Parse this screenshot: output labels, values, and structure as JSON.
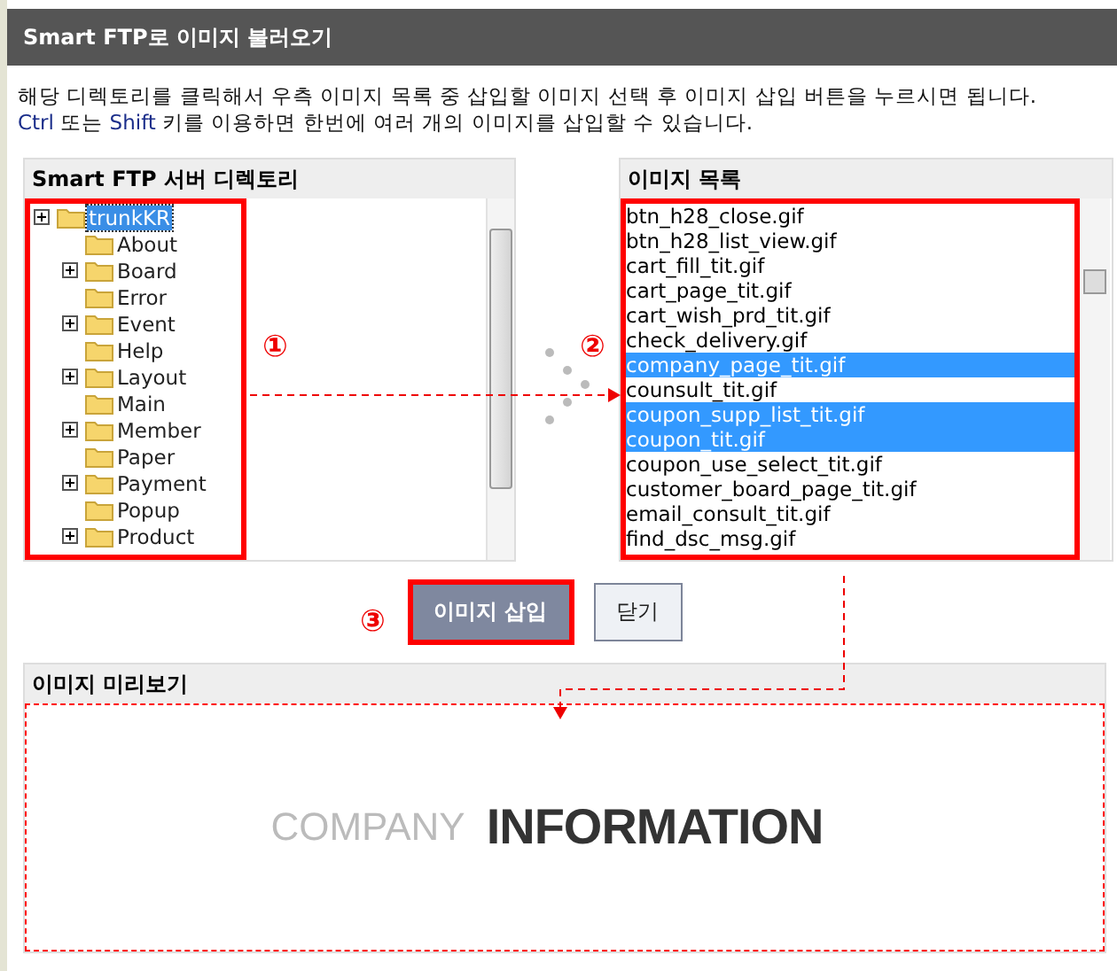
{
  "window": {
    "title": "Smart FTP로 이미지 불러오기"
  },
  "instructions": [
    {
      "segments": [
        {
          "kind": "plain",
          "text": "해당 디렉토리를 클릭해서 우측 이미지 목록 중 삽입할 이미지 선택 후 이미지 삽입 버튼을 누르시면 됩니다."
        }
      ]
    },
    {
      "segments": [
        {
          "kind": "key",
          "text": "Ctrl"
        },
        {
          "kind": "plain",
          "text": " 또는 "
        },
        {
          "kind": "key",
          "text": "Shift"
        },
        {
          "kind": "plain",
          "text": " 키를 이용하면 한번에 여러 개의 이미지를 삽입할 수 있습니다."
        }
      ]
    }
  ],
  "directory_panel": {
    "title": "Smart FTP 서버 디렉토리",
    "marker": "①",
    "root": {
      "label": "trunkKR",
      "expandable": true,
      "selected": true,
      "children": [
        {
          "label": "About",
          "expandable": false,
          "selected": false
        },
        {
          "label": "Board",
          "expandable": true,
          "selected": false
        },
        {
          "label": "Error",
          "expandable": false,
          "selected": false
        },
        {
          "label": "Event",
          "expandable": true,
          "selected": false
        },
        {
          "label": "Help",
          "expandable": false,
          "selected": false
        },
        {
          "label": "Layout",
          "expandable": true,
          "selected": false
        },
        {
          "label": "Main",
          "expandable": false,
          "selected": false
        },
        {
          "label": "Member",
          "expandable": true,
          "selected": false
        },
        {
          "label": "Paper",
          "expandable": false,
          "selected": false
        },
        {
          "label": "Payment",
          "expandable": true,
          "selected": false
        },
        {
          "label": "Popup",
          "expandable": false,
          "selected": false
        },
        {
          "label": "Product",
          "expandable": true,
          "selected": false
        }
      ]
    }
  },
  "image_panel": {
    "title": "이미지 목록",
    "marker": "②",
    "items": [
      {
        "label": "btn_h28_close.gif",
        "selected": false
      },
      {
        "label": "btn_h28_list_view.gif",
        "selected": false
      },
      {
        "label": "cart_fill_tit.gif",
        "selected": false
      },
      {
        "label": "cart_page_tit.gif",
        "selected": false
      },
      {
        "label": "cart_wish_prd_tit.gif",
        "selected": false
      },
      {
        "label": "check_delivery.gif",
        "selected": false
      },
      {
        "label": "company_page_tit.gif",
        "selected": true
      },
      {
        "label": "counsult_tit.gif",
        "selected": false
      },
      {
        "label": "coupon_supp_list_tit.gif",
        "selected": true
      },
      {
        "label": "coupon_tit.gif",
        "selected": true
      },
      {
        "label": "coupon_use_select_tit.gif",
        "selected": false
      },
      {
        "label": "customer_board_page_tit.gif",
        "selected": false
      },
      {
        "label": "email_consult_tit.gif",
        "selected": false
      },
      {
        "label": "find_dsc_msg.gif",
        "selected": false
      }
    ]
  },
  "buttons": {
    "marker": "③",
    "insert": "이미지 삽입",
    "close": "닫기"
  },
  "preview_panel": {
    "title": "이미지 미리보기",
    "light_text": "COMPANY",
    "bold_text": "INFORMATION"
  }
}
